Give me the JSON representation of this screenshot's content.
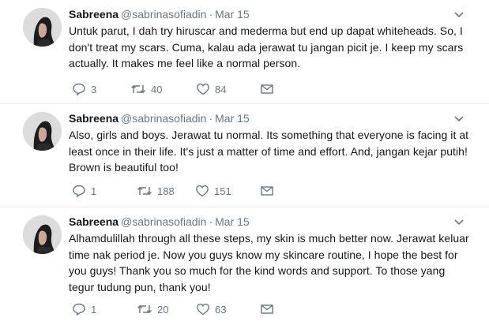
{
  "tweets": [
    {
      "name": "Sabreena",
      "handle": "@sabrinasofiadin",
      "separator": "·",
      "time": "Mar 15",
      "lines": [
        "Untuk parut, I dah try hiruscar and mederma but end up dapat whiteheads. So, I",
        "don't treat my scars. Cuma, kalau ada jerawat tu jangan picit je. I keep my scars",
        "actually. It makes me feel like a normal person."
      ],
      "replies": "3",
      "retweets": "40",
      "likes": "84"
    },
    {
      "name": "Sabreena",
      "handle": "@sabrinasofiadin",
      "separator": "·",
      "time": "Mar 15",
      "lines": [
        "Also, girls and boys. Jerawat tu normal. Its something that everyone is facing it at",
        "least once in their life. It's just a matter of time and effort. And, jangan kejar putih!",
        "Brown is beautiful too!"
      ],
      "replies": "1",
      "retweets": "188",
      "likes": "151"
    },
    {
      "name": "Sabreena",
      "handle": "@sabrinasofiadin",
      "separator": "·",
      "time": "Mar 15",
      "lines": [
        "Alhamdulillah through all these steps, my skin is much better now. Jerawat keluar",
        "time nak period je. Now you guys know my skincare routine, I hope the best for",
        "you guys! Thank you so much for the kind words and support. To those yang",
        "tegur tudung pun, thank you!"
      ],
      "replies": "1",
      "retweets": "20",
      "likes": "63"
    }
  ],
  "icons": {
    "reply": "reply-icon",
    "retweet": "retweet-icon",
    "like": "heart-icon",
    "message": "direct-message-icon",
    "menu": "chevron-down-icon"
  },
  "colors": {
    "text": "#14171a",
    "muted": "#657786",
    "divider": "#e6ecf0"
  }
}
